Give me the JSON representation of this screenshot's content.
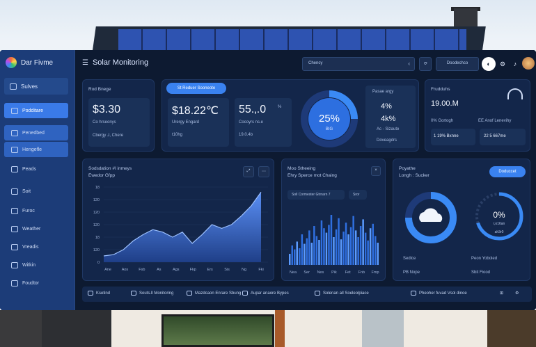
{
  "app": {
    "name": "Dar Fivme",
    "page_title": "Solar Monitoring"
  },
  "header": {
    "select_value": "Chency",
    "button_label": "Doodechco"
  },
  "sidebar": {
    "top_button": "Sulves",
    "items": [
      {
        "label": "Podditare",
        "state": "active"
      },
      {
        "label": "Penedbed",
        "state": "soft"
      },
      {
        "label": "Hengefle",
        "state": "soft"
      },
      {
        "label": "Peads",
        "state": ""
      },
      {
        "label": "Soit",
        "state": ""
      },
      {
        "label": "Furoc",
        "state": ""
      },
      {
        "label": "Weather",
        "state": ""
      },
      {
        "label": "Vreadis",
        "state": ""
      },
      {
        "label": "Witkin",
        "state": ""
      },
      {
        "label": "Foudtor",
        "state": ""
      }
    ]
  },
  "kpi": {
    "label": "Rod Bnege",
    "tab": "St Reduer Sooneote",
    "c1": {
      "value": "$3.30",
      "sub": "Co hrseonys",
      "foot": "Cbergy ⅃, Chere"
    },
    "c2": {
      "value": "$18.22℃",
      "sub": "Urergy Engard",
      "foot": "t10hg"
    },
    "c3": {
      "value": "55.‚.0",
      "unit": "%",
      "sub": "Cocoyrs ns.e",
      "foot": "19.0.4b"
    },
    "gauge": {
      "value": "25%",
      "sub": "BIG",
      "fraction": 0.25
    },
    "c4": {
      "label": "Pasae argy",
      "v1": "4%",
      "v2": "4k%",
      "sub": "Ac - Sizaute",
      "foot": "Doveagdrs"
    }
  },
  "right_kpi": {
    "label": "Frudduhs",
    "value": "19.00.M",
    "r1": "0% Gortogh",
    "r2": "EE Anof Lenevihy",
    "b1": "1 19% Bxnne",
    "b2": "22 5 667me"
  },
  "area_card": {
    "title": "Sodsdation #I inmeys",
    "subtitle": "Ewedor Gfpp",
    "y_ticks": [
      "18",
      "120",
      "120",
      "120",
      "18",
      "120",
      "0"
    ],
    "x_ticks": [
      "Ane",
      "Aos",
      "Fsb",
      "As",
      "Ags",
      "Fkp",
      "Ers",
      "Sis",
      "Ng",
      "Fki"
    ]
  },
  "bar_card": {
    "title": "Moo Stheeing",
    "subtitle": "Ehry Sperce mot Chaing",
    "filter": "Soll Cormester Gtrnarn 7",
    "button": "Sror",
    "x_ticks": [
      "Nea",
      "Ser",
      "Nes",
      "Pik",
      "Fet",
      "Fnb",
      "Fmp"
    ]
  },
  "weather_card": {
    "title": "Poyathe",
    "subtitle": "Longh : Sucker",
    "badge": "Doduccet",
    "ring_value": "0%",
    "ring_sub": "r,o16an",
    "ring_tag": "ah3r0",
    "ring_fraction": 0.7,
    "l1": "Sedlce",
    "l2": "Peon Yoboled",
    "l3": "PB Nope",
    "l4": "Sbit Fiood"
  },
  "bottom_bar": {
    "items": [
      "Ksetind",
      "Souts.ll Monitoring",
      "Mazdcaon Enrare Sbung",
      "Aupar anaore Bypes",
      "Solenan all Soeleolpiace",
      "Pheoher fuvad Vsol dinoe"
    ]
  },
  "chart_data": [
    {
      "type": "area",
      "x": [
        "Ane",
        "Aos",
        "Fsb",
        "As",
        "Ags",
        "Fkp",
        "Ers",
        "Sis",
        "Ng",
        "Fki"
      ],
      "values": [
        5,
        6,
        10,
        17,
        22,
        26,
        24,
        20,
        24,
        15,
        22,
        30,
        27,
        30,
        37,
        45,
        56
      ]
    },
    {
      "type": "bar",
      "x": [
        "Nea",
        "Ser",
        "Nes",
        "Pik",
        "Fet",
        "Fnb",
        "Fmp"
      ],
      "values": [
        20,
        35,
        28,
        42,
        30,
        55,
        38,
        48,
        62,
        40,
        70,
        52,
        45,
        80,
        66,
        58,
        72,
        90,
        50,
        64,
        84,
        46,
        60,
        76,
        55,
        68,
        88,
        62,
        50,
        70,
        82,
        58,
        44,
        66,
        74,
        52,
        40
      ]
    }
  ]
}
